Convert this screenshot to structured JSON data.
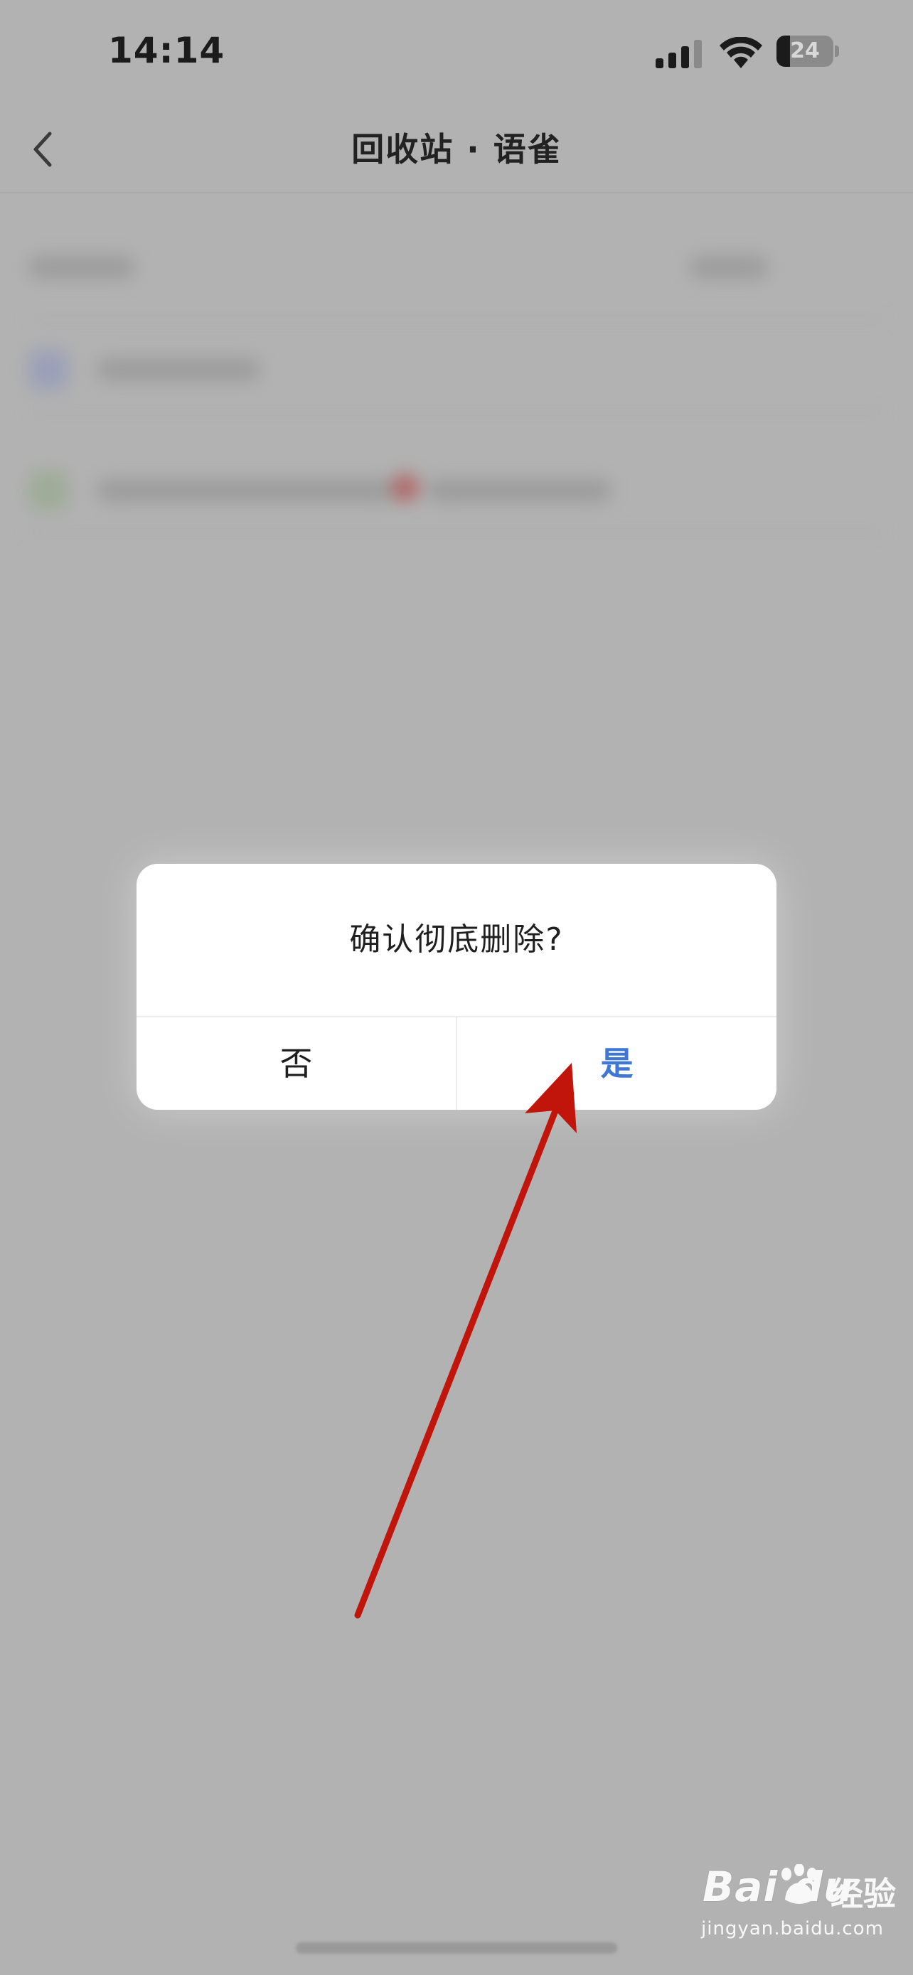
{
  "status_bar": {
    "time": "14:14",
    "battery_level": "24",
    "battery_fraction": 0.24,
    "signal_icon": "cellular-signal-icon",
    "wifi_icon": "wifi-icon"
  },
  "nav": {
    "title": "回收站 · 语雀",
    "back_icon": "chevron-left-icon"
  },
  "dialog": {
    "message": "确认彻底删除?",
    "cancel_label": "否",
    "confirm_label": "是"
  },
  "watermark": {
    "logo_text": "Bai du",
    "name": "经验",
    "url": "jingyan.baidu.com"
  },
  "colors": {
    "confirm": "#3f78d4",
    "arrow": "#c1150c",
    "overlay_gray": "#b2b2b2"
  }
}
